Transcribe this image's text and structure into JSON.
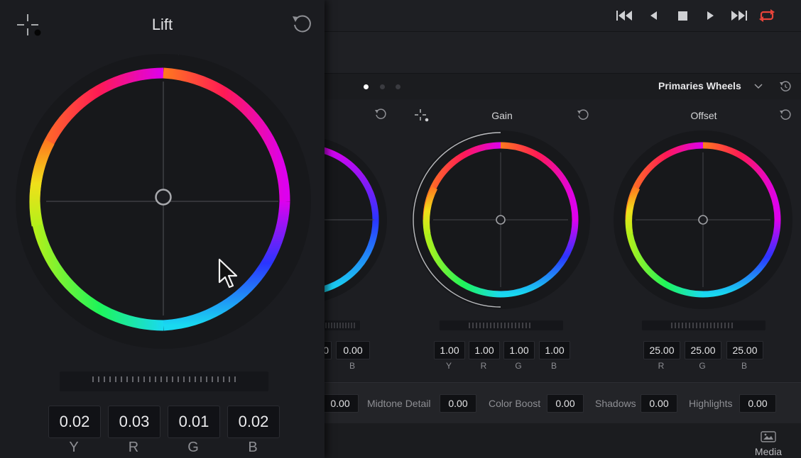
{
  "colors": {
    "background": "#1b1c20",
    "loop_active": "#e8443a",
    "active_dot": "#ffffff"
  },
  "transport": {
    "buttons": [
      "skip-to-start-icon",
      "step-back-icon",
      "stop-icon",
      "play-icon",
      "skip-to-end-icon",
      "loop-icon"
    ]
  },
  "header": {
    "page_dots": 3,
    "active_dot": 0,
    "mode": "Primaries Wheels"
  },
  "lift": {
    "title": "Lift",
    "values": [
      "0.02",
      "0.03",
      "0.01",
      "0.02"
    ],
    "channels": [
      "Y",
      "R",
      "G",
      "B"
    ]
  },
  "partial_wheel": {
    "values": [
      "0",
      "0.00"
    ],
    "channels": [
      "B"
    ]
  },
  "gain": {
    "title": "Gain",
    "values": [
      "1.00",
      "1.00",
      "1.00",
      "1.00"
    ],
    "channels": [
      "Y",
      "R",
      "G",
      "B"
    ]
  },
  "offset": {
    "title": "Offset",
    "values": [
      "25.00",
      "25.00",
      "25.00"
    ],
    "channels": [
      "R",
      "G",
      "B"
    ]
  },
  "params": [
    {
      "label": "",
      "value": "0.00"
    },
    {
      "label": "Midtone Detail",
      "value": "0.00"
    },
    {
      "label": "Color Boost",
      "value": "0.00"
    },
    {
      "label": "Shadows",
      "value": "0.00"
    },
    {
      "label": "Highlights",
      "value": "0.00"
    }
  ],
  "footer": {
    "media_label": "Media"
  }
}
